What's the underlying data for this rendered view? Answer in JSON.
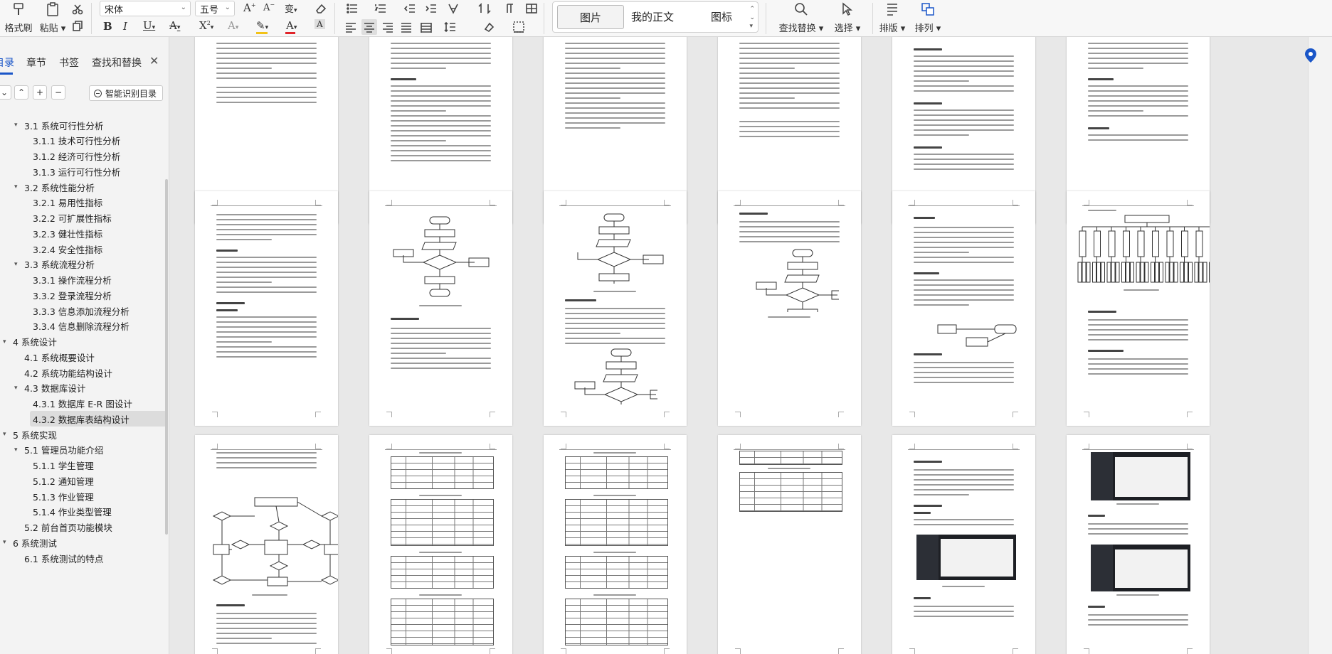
{
  "ribbon": {
    "format_painter": "格式刷",
    "paste": "粘贴",
    "font_name": "宋体",
    "font_size": "五号",
    "styles": {
      "selected": "图片",
      "items": [
        "我的正文",
        "图标"
      ]
    },
    "find_replace": "查找替换",
    "select": "选择",
    "layout": "排版",
    "arrange": "排列",
    "font_color": "#e0242a",
    "highlight_color": "#f2c218",
    "accent": "#1a56c8"
  },
  "nav": {
    "tabs": [
      "目录",
      "章节",
      "书签",
      "查找和替换"
    ],
    "close": "✕",
    "controls": [
      "⌄",
      "⌃",
      "+",
      "−"
    ],
    "smart_toc": "智能识别目录",
    "toc": [
      {
        "label": "3.1  系统可行性分析",
        "level": 1,
        "expanded": true
      },
      {
        "label": "3.1.1  技术可行性分析",
        "level": 2
      },
      {
        "label": "3.1.2  经济可行性分析",
        "level": 2
      },
      {
        "label": "3.1.3  运行可行性分析",
        "level": 2
      },
      {
        "label": "3.2  系统性能分析",
        "level": 1,
        "expanded": true
      },
      {
        "label": "3.2.1  易用性指标",
        "level": 2
      },
      {
        "label": "3.2.2  可扩展性指标",
        "level": 2
      },
      {
        "label": "3.2.3  健壮性指标",
        "level": 2
      },
      {
        "label": "3.2.4  安全性指标",
        "level": 2
      },
      {
        "label": "3.3  系统流程分析",
        "level": 1,
        "expanded": true
      },
      {
        "label": "3.3.1  操作流程分析",
        "level": 2
      },
      {
        "label": "3.3.2  登录流程分析",
        "level": 2
      },
      {
        "label": "3.3.3  信息添加流程分析",
        "level": 2
      },
      {
        "label": "3.3.4  信息删除流程分析",
        "level": 2
      },
      {
        "label": "4  系统设计",
        "level": 0,
        "expanded": true
      },
      {
        "label": "4.1  系统概要设计",
        "level": 1
      },
      {
        "label": "4.2  系统功能结构设计",
        "level": 1
      },
      {
        "label": "4.3  数据库设计",
        "level": 1,
        "expanded": true
      },
      {
        "label": "4.3.1  数据库 E-R 图设计",
        "level": 2
      },
      {
        "label": "4.3.2  数据库表结构设计",
        "level": 2,
        "selected": true
      },
      {
        "label": "5  系统实现",
        "level": 0,
        "expanded": true
      },
      {
        "label": "5.1  管理员功能介绍",
        "level": 1,
        "expanded": true
      },
      {
        "label": "5.1.1  学生管理",
        "level": 2
      },
      {
        "label": "5.1.2  通知管理",
        "level": 2
      },
      {
        "label": "5.1.3  作业管理",
        "level": 2
      },
      {
        "label": "5.1.4  作业类型管理",
        "level": 2
      },
      {
        "label": "5.2  前台首页功能模块",
        "level": 1
      },
      {
        "label": "6  系统测试",
        "level": 0,
        "expanded": true
      },
      {
        "label": "6.1  系统测试的特点",
        "level": 1
      }
    ]
  }
}
